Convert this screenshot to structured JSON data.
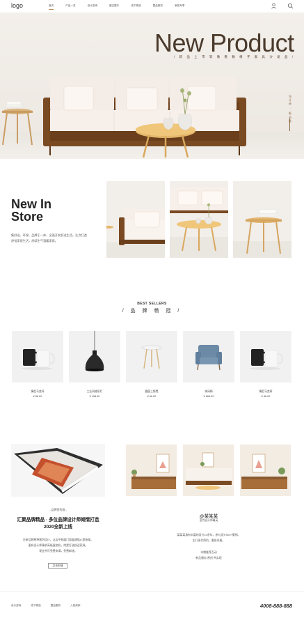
{
  "nav": {
    "logo": "logo",
    "links": [
      "首页",
      "产品一览",
      "设计咨询",
      "度空展厅",
      "线下精选",
      "整品服务",
      "家装专享"
    ],
    "user_icon": "user-icon",
    "search_icon": "search-icon"
  },
  "hero": {
    "title": "New Product",
    "subtitle": "/ 新 品 上 市 等 像 看 数 椅 子 家 具 沙 发 品 /",
    "side_text": "设计师 · 新品推",
    "accent": "#4a3a2c"
  },
  "new_in_store": {
    "title": "New In Store",
    "description": "集舒适、环保、品牌于一体，全面开发舒适生活。注点打造舒适家居生活，阅读生气温暖家居。"
  },
  "best_sellers": {
    "title_en": "BEST SELLERS",
    "title_cn": "/ 品 牌 畅 冠 /",
    "products": [
      {
        "name": "情侣马克杯",
        "price": "¥ 86.00",
        "icon": "mug-pair-icon"
      },
      {
        "name": "工业风格吊灯",
        "price": "¥ 198.00",
        "icon": "pendant-lamp-icon"
      },
      {
        "name": "圆面三角凳",
        "price": "¥ 66.00",
        "icon": "stool-icon"
      },
      {
        "name": "休闲椅",
        "price": "¥ 666.00",
        "icon": "armchair-icon"
      },
      {
        "name": "情侣马克杯",
        "price": "¥ 86.00",
        "icon": "mug-pair-icon"
      }
    ]
  },
  "article": {
    "label": "- 品牌宣传画 -",
    "title_line1": "汇聚品牌精品 · 多位品牌设计师倾情打造",
    "title_line2": "2020全新上线",
    "desc_line1": "日新品牌原种客列设计，让店平拓展门面展通强心宽装高。",
    "desc_line2": "更有设计师精求高级展览机，附是打造舒适家具。",
    "desc_line3": "现金共可免费申请，免费邮递。",
    "button": "点击申请"
  },
  "designer": {
    "name": "@某某某",
    "role": "室内设计师精英",
    "bio_line1": "某某某具有丰富的设计10余年，参与设计500+案例。",
    "bio_line2": "主打现代简约，奢侈风格。",
    "note_line1": "本期推荐互动",
    "note_line2": "新品服务 原创·共实现"
  },
  "footer": {
    "links": [
      "设计咨询",
      "线下精选",
      "整品服务",
      "入驻商家"
    ],
    "phone": "4008-888-888"
  }
}
